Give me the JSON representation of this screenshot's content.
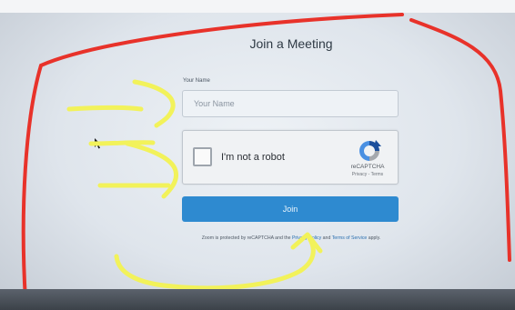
{
  "page": {
    "title": "Join a Meeting",
    "name_label": "Your Name",
    "name_placeholder": "Your Name"
  },
  "captcha": {
    "checkbox_label": "I'm not a robot",
    "brand": "reCAPTCHA",
    "privacy": "Privacy",
    "separator": " - ",
    "terms": "Terms"
  },
  "join_button": {
    "label": "Join"
  },
  "footer": {
    "prefix": "Zoom is protected by reCAPTCHA and the ",
    "privacy_link": "Privacy Policy",
    "middle": " and ",
    "terms_link": "Terms of Service",
    "suffix": " apply."
  },
  "colors": {
    "button": "#2e8ad0",
    "annotation_red": "#e8322a",
    "annotation_yellow": "#f2f25a"
  }
}
